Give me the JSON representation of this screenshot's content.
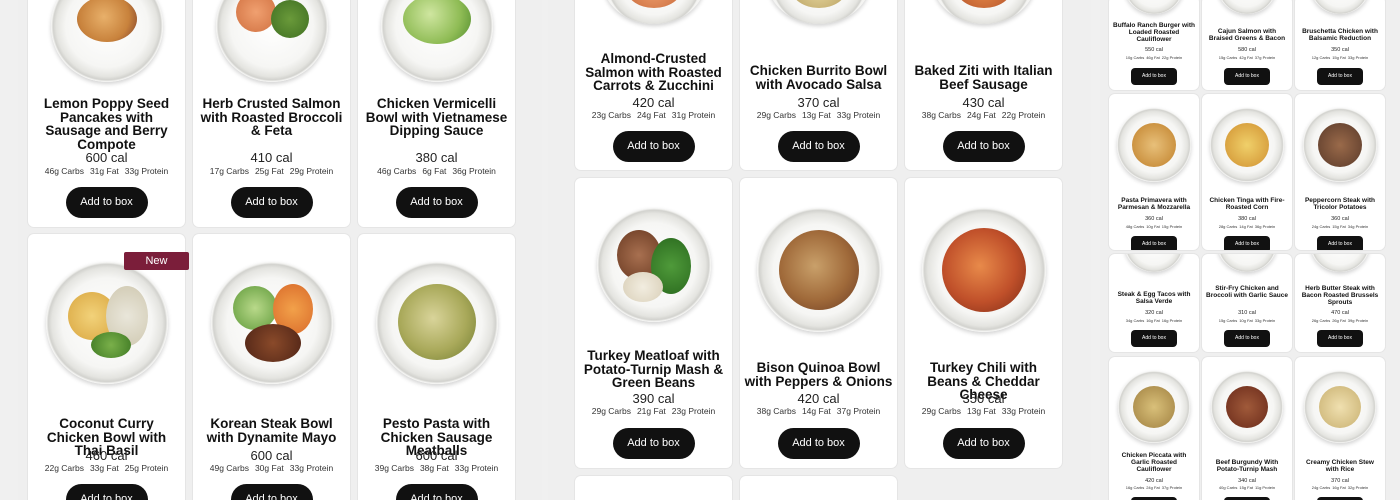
{
  "button_label": "Add to box",
  "badge_label": "New",
  "panel1": {
    "cards": [
      {
        "name": "Lemon Poppy Seed Pancakes with Sausage and Berry Compote",
        "cal": "600 cal",
        "carbs": "46g Carbs",
        "fat": "31g Fat",
        "protein": "33g Protein"
      },
      {
        "name": "Herb Crusted Salmon with Roasted Broccoli & Feta",
        "cal": "410 cal",
        "carbs": "17g Carbs",
        "fat": "25g Fat",
        "protein": "29g Protein"
      },
      {
        "name": "Chicken Vermicelli Bowl with Vietnamese Dipping Sauce",
        "cal": "380 cal",
        "carbs": "46g Carbs",
        "fat": "6g Fat",
        "protein": "36g Protein"
      },
      {
        "name": "Coconut Curry Chicken Bowl with Thai Basil",
        "cal": "460 cal",
        "carbs": "22g Carbs",
        "fat": "33g Fat",
        "protein": "25g Protein"
      },
      {
        "name": "Korean Steak Bowl with Dynamite Mayo",
        "cal": "600 cal",
        "carbs": "49g Carbs",
        "fat": "30g Fat",
        "protein": "33g Protein"
      },
      {
        "name": "Pesto Pasta with Chicken Sausage Meatballs",
        "cal": "600 cal",
        "carbs": "39g Carbs",
        "fat": "38g Fat",
        "protein": "33g Protein"
      }
    ]
  },
  "panel2": {
    "cards": [
      {
        "name": "Almond-Crusted Salmon with Roasted Carrots & Zucchini",
        "cal": "420 cal",
        "carbs": "23g Carbs",
        "fat": "24g Fat",
        "protein": "31g Protein"
      },
      {
        "name": "Chicken Burrito Bowl with Avocado Salsa",
        "cal": "370 cal",
        "carbs": "29g Carbs",
        "fat": "13g Fat",
        "protein": "33g Protein"
      },
      {
        "name": "Baked Ziti with Italian Beef Sausage",
        "cal": "430 cal",
        "carbs": "38g Carbs",
        "fat": "24g Fat",
        "protein": "22g Protein"
      },
      {
        "name": "Turkey Meatloaf with Potato-Turnip Mash & Green Beans",
        "cal": "390 cal",
        "carbs": "29g Carbs",
        "fat": "21g Fat",
        "protein": "23g Protein"
      },
      {
        "name": "Bison Quinoa Bowl with Peppers & Onions",
        "cal": "420 cal",
        "carbs": "38g Carbs",
        "fat": "14g Fat",
        "protein": "37g Protein"
      },
      {
        "name": "Turkey Chili with Beans & Cheddar Cheese",
        "cal": "350 cal",
        "carbs": "29g Carbs",
        "fat": "13g Fat",
        "protein": "33g Protein"
      }
    ]
  },
  "panel3": {
    "cards": [
      {
        "name": "Buffalo Ranch Burger with Loaded Roasted Cauliflower",
        "cal": "550 cal",
        "carbs": "10g Carbs",
        "fat": "46g Fat",
        "protein": "22g Protein"
      },
      {
        "name": "Cajun Salmon with Braised Greens & Bacon",
        "cal": "580 cal",
        "carbs": "15g Carbs",
        "fat": "42g Fat",
        "protein": "37g Protein"
      },
      {
        "name": "Bruschetta Chicken with Balsamic Reduction",
        "cal": "350 cal",
        "carbs": "12g Carbs",
        "fat": "15g Fat",
        "protein": "33g Protein"
      },
      {
        "name": "Pasta Primavera with Parmesan & Mozzarella",
        "cal": "360 cal",
        "carbs": "48g Carbs",
        "fat": "10g Fat",
        "protein": "15g Protein"
      },
      {
        "name": "Chicken Tinga with Fire-Roasted Corn",
        "cal": "380 cal",
        "carbs": "28g Carbs",
        "fat": "14g Fat",
        "protein": "36g Protein"
      },
      {
        "name": "Peppercorn Steak with Tricolor Potatoes",
        "cal": "360 cal",
        "carbs": "24g Carbs",
        "fat": "15g Fat",
        "protein": "34g Protein"
      },
      {
        "name": "Steak & Egg Tacos with Salsa Verde",
        "cal": "320 cal",
        "carbs": "34g Carbs",
        "fat": "16g Fat",
        "protein": "16g Protein"
      },
      {
        "name": "Stir-Fry Chicken and Broccoli with Garlic Sauce",
        "cal": "310 cal",
        "carbs": "15g Carbs",
        "fat": "10g Fat",
        "protein": "33g Protein"
      },
      {
        "name": "Herb Butter Steak with Bacon Roasted Brussels Sprouts",
        "cal": "470 cal",
        "carbs": "26g Carbs",
        "fat": "26g Fat",
        "protein": "39g Protein"
      },
      {
        "name": "Chicken Piccata with Garlic Roasted Cauliflower",
        "cal": "420 cal",
        "carbs": "16g Carbs",
        "fat": "24g Fat",
        "protein": "37g Protein"
      },
      {
        "name": "Beef Burgundy With Potato-Turnip Mash",
        "cal": "340 cal",
        "carbs": "40g Carbs",
        "fat": "15g Fat",
        "protein": "11g Protein"
      },
      {
        "name": "Creamy Chicken Stew with Rice",
        "cal": "370 cal",
        "carbs": "24g Carbs",
        "fat": "16g Fat",
        "protein": "32g Protein"
      }
    ]
  }
}
